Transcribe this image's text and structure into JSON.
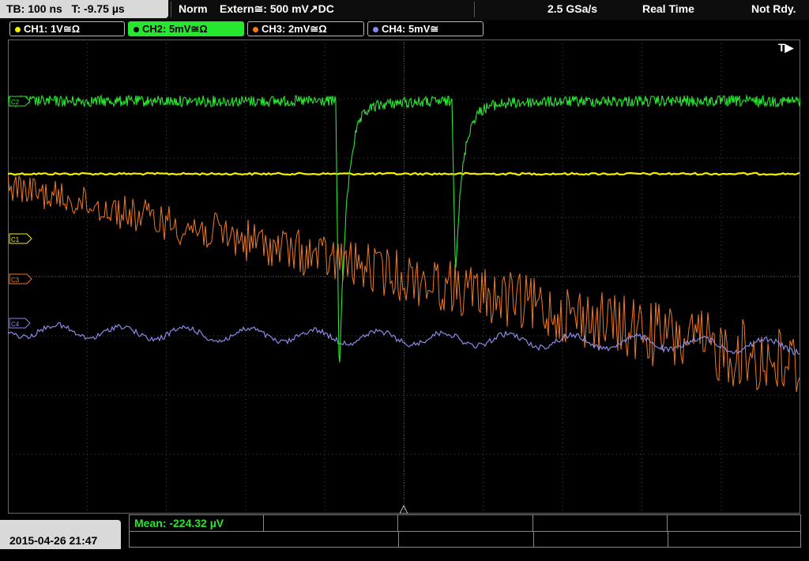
{
  "header": {
    "timebase": "TB: 100 ns",
    "trigger_time": "T: -9.75 µs",
    "acq_mode": "Norm",
    "trigger_source": "Extern≅: 500 mV",
    "trigger_slope": "↗",
    "trigger_coupling": "DC",
    "sample_rate": "2.5 GSa/s",
    "acq_type": "Real Time",
    "trigger_state": "Not Rdy."
  },
  "channels": [
    {
      "label": "CH1: 1V≅Ω",
      "color": "#f5f000",
      "active": false
    },
    {
      "label": "CH2: 5mV≅Ω",
      "color": "#27e62e",
      "active": true
    },
    {
      "label": "CH3: 2mV≅Ω",
      "color": "#f07a22",
      "active": false
    },
    {
      "label": "CH4: 5mV≅",
      "color": "#8888ee",
      "active": false
    }
  ],
  "markers": {
    "c1": "C1",
    "c2": "C2",
    "c3": "C3",
    "c4": "C4",
    "trigger": "T▶"
  },
  "measurement": {
    "mean": "Mean: -224.32 µV"
  },
  "footer": {
    "datetime": "2015-04-26 21:47"
  },
  "colors": {
    "ch1": "#f5f000",
    "ch2": "#27e62e",
    "ch3": "#f07a22",
    "ch4": "#8a8ae8",
    "grid": "#3a3a3a"
  }
}
